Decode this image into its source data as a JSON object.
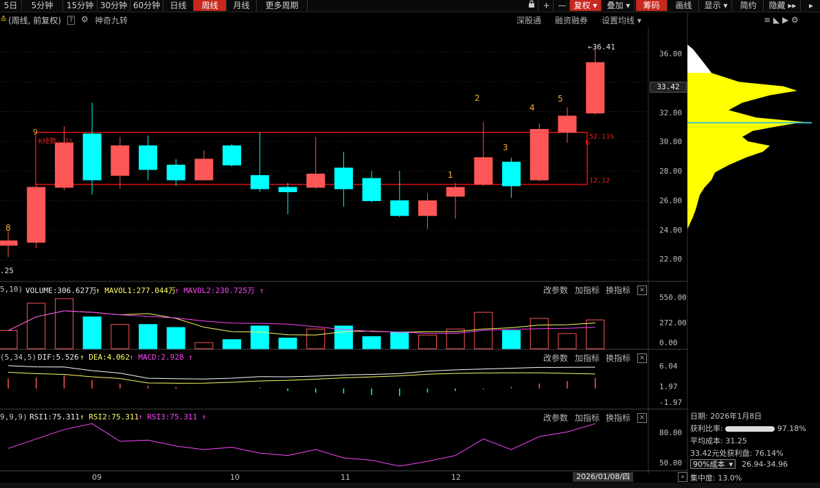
{
  "toolbar": {
    "left_items": [
      "5日",
      "5分钟",
      "15分钟",
      "30分钟",
      "60分钟",
      "日线",
      "周线",
      "月线",
      "更多周期"
    ],
    "right_items": [
      "复权",
      "叠加",
      "筹码",
      "画线",
      "显示",
      "简约",
      "隐藏"
    ],
    "plus": "+",
    "minus": "—",
    "lock": "🔒"
  },
  "subbar": {
    "title": "(周线, 前复权)",
    "help": "?",
    "indicator": "神奇九转",
    "sgt": "深股通",
    "margin": "融资融券",
    "ma_setting": "设置均线"
  },
  "main_chart": {
    "price_axis": [
      "36.00",
      "34.00",
      "32.00",
      "30.00",
      "28.00",
      "26.00",
      "24.00",
      "22.00"
    ],
    "current_price": "33.42",
    "high_label": "36.41",
    "low_label": ".25",
    "box_label": "K线数: 21",
    "box_pct": "52.11%",
    "box_low": "12.12",
    "box_num_top": "9",
    "box_num_right": "6",
    "nine_count": [
      "8",
      "1",
      "2",
      "3",
      "4",
      "5"
    ]
  },
  "chart_data": {
    "type": "candlestick",
    "ylim": [
      20.8,
      37.2
    ],
    "candles": [
      {
        "o": 23.0,
        "c": 23.3,
        "h": 24.0,
        "l": 22.2
      },
      {
        "o": 23.2,
        "c": 26.9,
        "h": 27.1,
        "l": 22.8
      },
      {
        "o": 26.9,
        "c": 29.9,
        "h": 31.0,
        "l": 26.7
      },
      {
        "o": 30.5,
        "c": 27.4,
        "h": 32.6,
        "l": 26.4
      },
      {
        "o": 27.7,
        "c": 29.7,
        "h": 30.3,
        "l": 26.8
      },
      {
        "o": 29.7,
        "c": 28.1,
        "h": 30.4,
        "l": 27.4
      },
      {
        "o": 28.4,
        "c": 27.4,
        "h": 28.8,
        "l": 27.0
      },
      {
        "o": 27.4,
        "c": 28.8,
        "h": 29.4,
        "l": 27.4
      },
      {
        "o": 29.7,
        "c": 28.4,
        "h": 29.8,
        "l": 28.3
      },
      {
        "o": 27.7,
        "c": 26.8,
        "h": 30.6,
        "l": 26.6
      },
      {
        "o": 26.9,
        "c": 26.6,
        "h": 27.2,
        "l": 25.1
      },
      {
        "o": 26.9,
        "c": 27.8,
        "h": 30.3,
        "l": 26.8
      },
      {
        "o": 28.2,
        "c": 26.8,
        "h": 29.3,
        "l": 25.6
      },
      {
        "o": 27.5,
        "c": 26.0,
        "h": 28.0,
        "l": 25.9
      },
      {
        "o": 26.0,
        "c": 25.0,
        "h": 28.0,
        "l": 24.9
      },
      {
        "o": 25.0,
        "c": 26.0,
        "h": 26.5,
        "l": 24.1
      },
      {
        "o": 26.3,
        "c": 26.9,
        "h": 27.2,
        "l": 24.8
      },
      {
        "o": 27.1,
        "c": 28.9,
        "h": 31.3,
        "l": 27.0
      },
      {
        "o": 28.6,
        "c": 27.0,
        "h": 28.9,
        "l": 26.2
      },
      {
        "o": 27.4,
        "c": 30.8,
        "h": 31.2,
        "l": 27.3
      },
      {
        "o": 30.6,
        "c": 31.7,
        "h": 32.3,
        "l": 29.9
      },
      {
        "o": 31.9,
        "c": 35.3,
        "h": 36.4,
        "l": 31.8
      }
    ],
    "volume": [
      120,
      300,
      330,
      210,
      160,
      160,
      140,
      40,
      60,
      150,
      70,
      130,
      150,
      80,
      110,
      90,
      130,
      240,
      120,
      200,
      100,
      190
    ],
    "macd_hist": [
      1.2,
      1.3,
      1.6,
      1.0,
      0.6,
      0.3,
      0.2,
      0.0,
      0.0,
      0.1,
      -0.3,
      -0.5,
      -0.6,
      -0.8,
      -0.9,
      -0.5,
      -0.3,
      -0.1,
      0.2,
      0.6,
      0.9,
      1.3
    ],
    "time_labels": [
      "09",
      "10",
      "11",
      "12"
    ],
    "cursor_date": "2026/01/08/四"
  },
  "volume_panel": {
    "params": "5,10)",
    "volume": "VOLUME:306.627万",
    "mavol1": "MAVOL1:277.044万",
    "mavol2": "MAVOL2:230.725万",
    "axis": [
      "550.00",
      "272.00",
      "0.00"
    ]
  },
  "macd_panel": {
    "params": "(5,34,5)",
    "dif": "DIF:5.526",
    "dea": "DEA:4.062",
    "macd": "MACD:2.928",
    "axis": [
      "6.04",
      "1.97",
      "-1.97"
    ]
  },
  "rsi_panel": {
    "params": "9,9,9)",
    "rsi1": "RSI1:75.311",
    "rsi2": "RSI2:75.311",
    "rsi3": "RSI3:75.311",
    "axis": [
      "80.00",
      "50.00"
    ]
  },
  "panel_buttons": {
    "params": "改参数",
    "add": "加指标",
    "switch": "换指标",
    "close": "×"
  },
  "chip_panel": {
    "date": "日期: 2026年1月8日",
    "profit_ratio_label": "获利比率:",
    "profit_ratio": "97.18%",
    "avg_cost": "平均成本: 31.25",
    "price_profit": "33.42元处获利盘: 76.14%",
    "cost_select": "90%成本",
    "cost_range": "26.94-34.96",
    "concentration": "集中度: 13.0%"
  },
  "colors": {
    "up": "#ff5757",
    "down": "#00ffff",
    "box": "#e01010",
    "chip": "#ffff00"
  }
}
